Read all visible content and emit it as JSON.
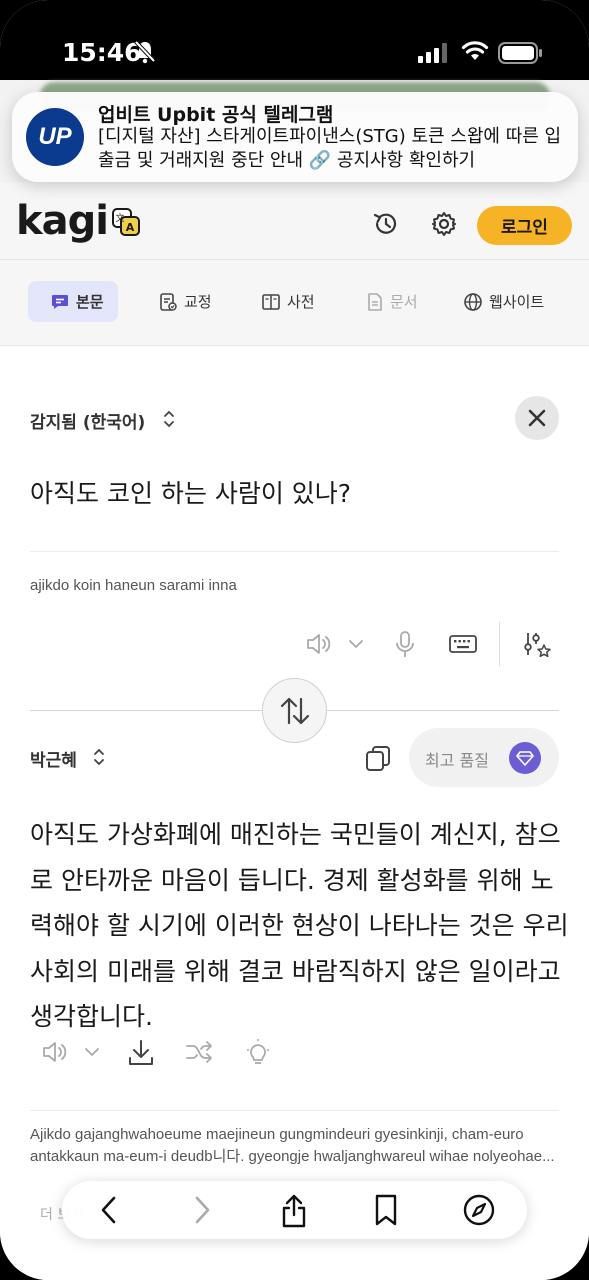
{
  "status_bar": {
    "time": "15:46"
  },
  "notification": {
    "logo_text": "UP",
    "title": "업비트 Upbit 공식 텔레그램",
    "body": "[디지털 자산] 스타게이트파이낸스(STG) 토큰 스왑에 따른 입출금 및 거래지원 중단 안내 🔗 공지사항 확인하기"
  },
  "header": {
    "logo": "kagi",
    "login_label": "로그인"
  },
  "tabs": [
    {
      "label": "본문"
    },
    {
      "label": "교정"
    },
    {
      "label": "사전"
    },
    {
      "label": "문서"
    },
    {
      "label": "웹사이트"
    }
  ],
  "source": {
    "language": "감지됨 (한국어)",
    "text": "아직도 코인 하는 사람이 있나?",
    "romanized": "ajikdo koin haneun sarami inna"
  },
  "target": {
    "language": "박근혜",
    "quality_label": "최고 품질",
    "text": "아직도 가상화폐에 매진하는 국민들이 계신지, 참으로 안타까운 마음이 듭니다. 경제 활성화를 위해 노력해야 할 시기에 이러한 현상이 나타나는 것은 우리 사회의 미래를 위해 결코 바람직하지 않은 일이라고 생각합니다.",
    "romanized": "Ajikdo gajanghwahoeume maejineun gungmindeuri gyesinkinji, cham-euro antakkaun ma-eum-i deudb니다. gyeongje hwaljanghwareul wihae nolyeohae...",
    "more_label": "더 보기"
  },
  "colors": {
    "accent": "#f5b325",
    "tab_active_bg": "#e3e5fa",
    "gem": "#6b5dd3"
  }
}
